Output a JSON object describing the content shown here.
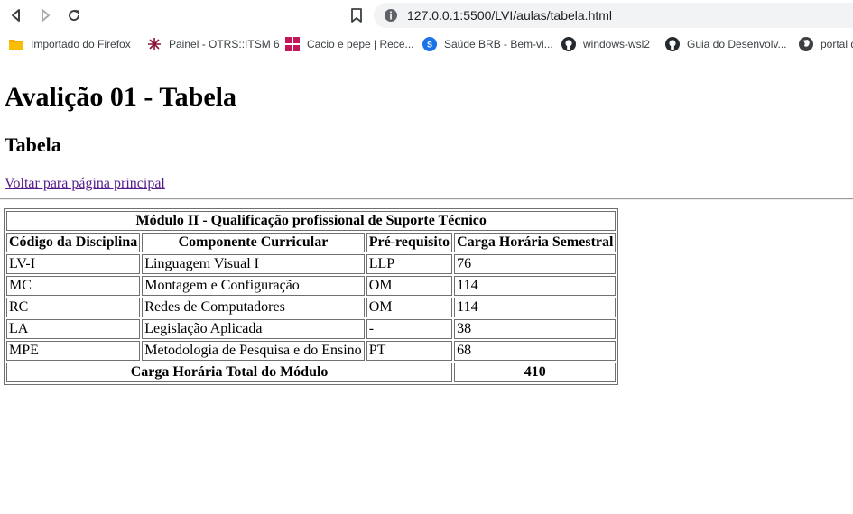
{
  "browser": {
    "url": "127.0.0.1:5500/LVI/aulas/tabela.html",
    "bookmarks": [
      {
        "label": "Importado do Firefox",
        "icon": "folder-icon"
      },
      {
        "label": "Painel - OTRS::ITSM 6",
        "icon": "otrs-icon"
      },
      {
        "label": "Cacio e pepe | Rece...",
        "icon": "recipe-site-icon"
      },
      {
        "label": "Saúde BRB - Bem-vi...",
        "icon": "brb-icon"
      },
      {
        "label": "windows-wsl2",
        "icon": "github-icon"
      },
      {
        "label": "Guia do Desenvolv...",
        "icon": "github-icon"
      },
      {
        "label": "portal d",
        "icon": "globe-icon"
      }
    ]
  },
  "page": {
    "title": "Avalição 01 - Tabela",
    "subtitle": "Tabela",
    "back_link": "Voltar para página principal"
  },
  "table": {
    "caption": "Módulo II - Qualificação profissional de Suporte Técnico",
    "headers": [
      "Código da Disciplina",
      "Componente Curricular",
      "Pré-requisito",
      "Carga Horária Semestral"
    ],
    "rows": [
      [
        "LV-I",
        "Linguagem Visual I",
        "LLP",
        "76"
      ],
      [
        "MC",
        "Montagem e Configuração",
        "OM",
        "114"
      ],
      [
        "RC",
        "Redes de Computadores",
        "OM",
        "114"
      ],
      [
        "LA",
        "Legislação Aplicada",
        "-",
        "38"
      ],
      [
        "MPE",
        "Metodologia de Pesquisa e do Ensino",
        "PT",
        "68"
      ]
    ],
    "total_label": "Carga Horária Total do Módulo",
    "total_value": "410"
  }
}
